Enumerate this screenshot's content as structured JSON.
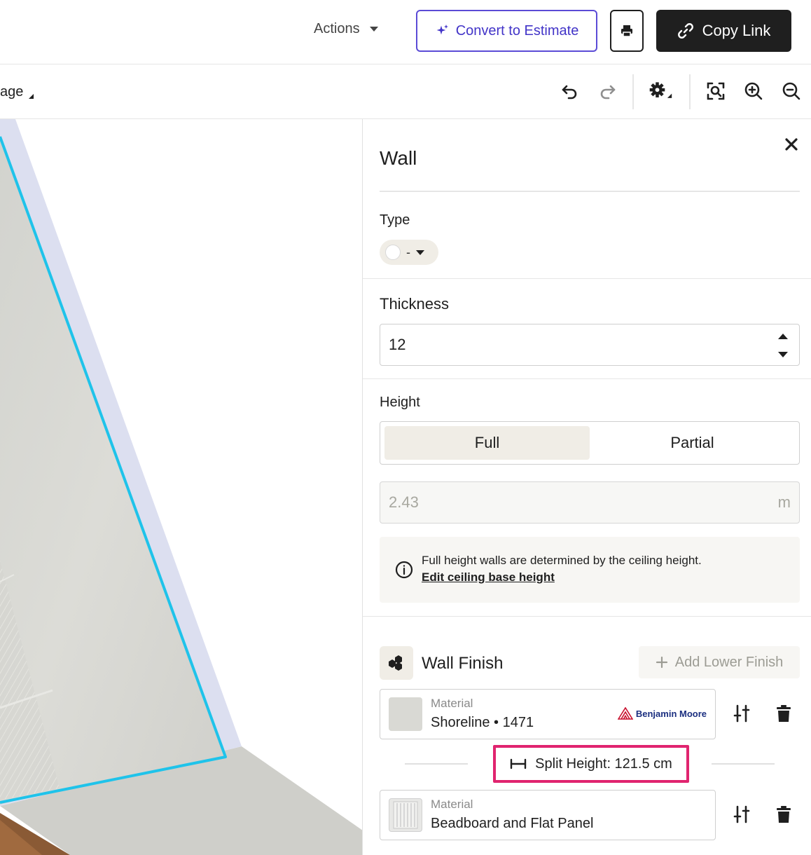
{
  "header": {
    "actions_label": "Actions",
    "convert_label": "Convert to Estimate",
    "copy_link_label": "Copy Link"
  },
  "toolbar": {
    "page_label": "age"
  },
  "panel": {
    "title": "Wall",
    "type": {
      "label": "Type",
      "value": "-"
    },
    "thickness": {
      "label": "Thickness",
      "value": "12"
    },
    "height": {
      "label": "Height",
      "options": [
        "Full",
        "Partial"
      ],
      "selected": "Full",
      "value": "2.43",
      "unit": "m",
      "info_text": "Full height walls are determined by the ceiling height.",
      "info_link": "Edit ceiling base height"
    },
    "wall_finish": {
      "title": "Wall Finish",
      "add_lower_label": "Add Lower Finish",
      "materials": [
        {
          "label": "Material",
          "value": "Shoreline • 1471",
          "brand": "Benjamin Moore",
          "swatch": "#d9d9d4"
        },
        {
          "label": "Material",
          "value": "Beadboard and Flat Panel"
        }
      ],
      "split_height_label": "Split Height: 121.5 cm"
    }
  },
  "colors": {
    "accent_purple": "#4234c8",
    "highlight_pink": "#e0246f",
    "wall_outline": "#1fc3ea"
  }
}
